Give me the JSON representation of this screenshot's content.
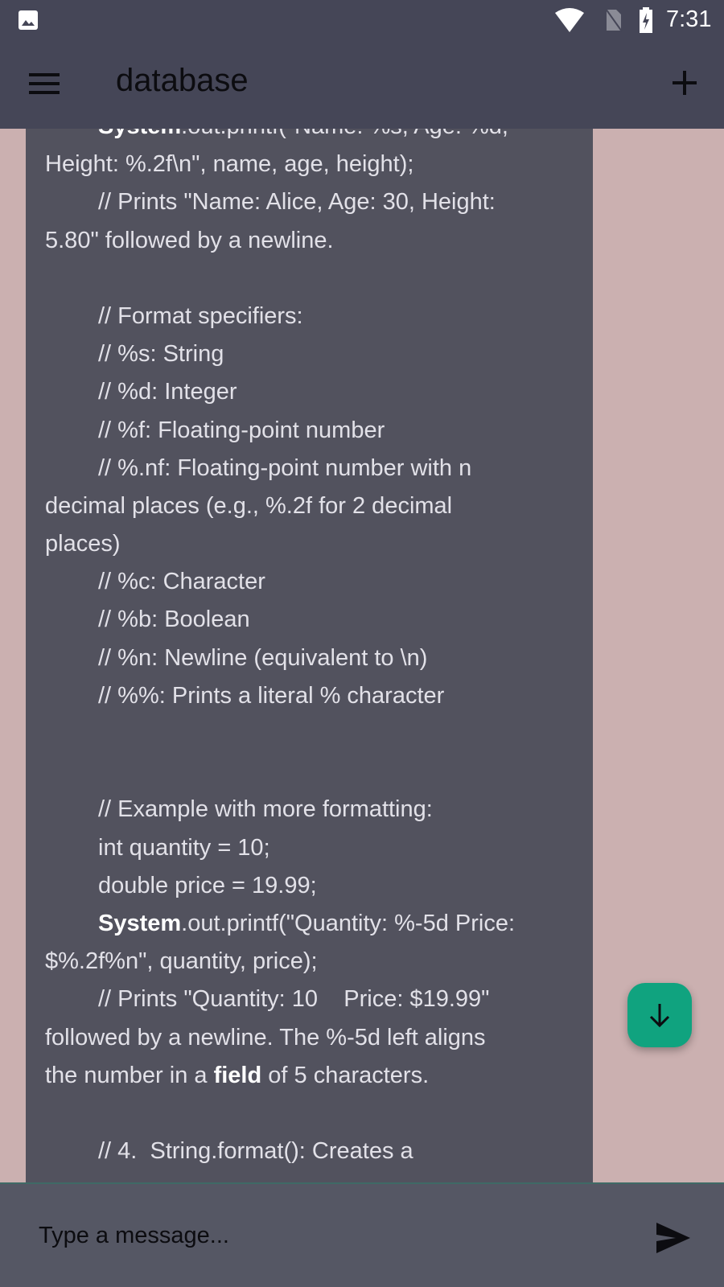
{
  "status_bar": {
    "time": "7:31",
    "icons": [
      "image-icon",
      "wifi-icon",
      "no-sim-icon",
      "battery-charging-icon"
    ]
  },
  "app_bar": {
    "title": "database",
    "menu_icon": "menu-icon",
    "add_icon": "plus-icon"
  },
  "message": {
    "lines": [
      {
        "indent": true,
        "segs": [
          {
            "t": "System",
            "b": true
          },
          {
            "t": ".out.printf(\"Name: %s, Age: %d,"
          }
        ]
      },
      {
        "indent": false,
        "segs": [
          {
            "t": "Height: %.2f\\n\", name, age, height);"
          }
        ]
      },
      {
        "indent": true,
        "segs": [
          {
            "t": "// Prints \"Name: Alice, Age: 30, Height:"
          }
        ]
      },
      {
        "indent": false,
        "segs": [
          {
            "t": "5.80\" followed by a newline."
          }
        ]
      },
      {
        "indent": false,
        "segs": [
          {
            "t": ""
          }
        ]
      },
      {
        "indent": true,
        "segs": [
          {
            "t": "// Format specifiers:"
          }
        ]
      },
      {
        "indent": true,
        "segs": [
          {
            "t": "// %s: String"
          }
        ]
      },
      {
        "indent": true,
        "segs": [
          {
            "t": "// %d: Integer"
          }
        ]
      },
      {
        "indent": true,
        "segs": [
          {
            "t": "// %f: Floating-point number"
          }
        ]
      },
      {
        "indent": true,
        "segs": [
          {
            "t": "// %.nf: Floating-point number with n"
          }
        ]
      },
      {
        "indent": false,
        "segs": [
          {
            "t": "decimal places (e.g., %.2f for 2 decimal"
          }
        ]
      },
      {
        "indent": false,
        "segs": [
          {
            "t": "places)"
          }
        ]
      },
      {
        "indent": true,
        "segs": [
          {
            "t": "// %c: Character"
          }
        ]
      },
      {
        "indent": true,
        "segs": [
          {
            "t": "// %b: Boolean"
          }
        ]
      },
      {
        "indent": true,
        "segs": [
          {
            "t": "// %n: Newline (equivalent to \\n)"
          }
        ]
      },
      {
        "indent": true,
        "segs": [
          {
            "t": "// %%: Prints a literal % character"
          }
        ]
      },
      {
        "indent": false,
        "segs": [
          {
            "t": ""
          }
        ]
      },
      {
        "indent": false,
        "segs": [
          {
            "t": ""
          }
        ]
      },
      {
        "indent": true,
        "segs": [
          {
            "t": "// Example with more formatting:"
          }
        ]
      },
      {
        "indent": true,
        "segs": [
          {
            "t": "int quantity = 10;"
          }
        ]
      },
      {
        "indent": true,
        "segs": [
          {
            "t": "double price = 19.99;"
          }
        ]
      },
      {
        "indent": true,
        "segs": [
          {
            "t": "System",
            "b": true
          },
          {
            "t": ".out.printf(\"Quantity: %-5d Price:"
          }
        ]
      },
      {
        "indent": false,
        "segs": [
          {
            "t": "$%.2f%n\", quantity, price);"
          }
        ]
      },
      {
        "indent": true,
        "segs": [
          {
            "t": "// Prints \"Quantity: 10    Price: $19.99\""
          }
        ]
      },
      {
        "indent": false,
        "segs": [
          {
            "t": "followed by a newline. The %-5d left aligns"
          }
        ]
      },
      {
        "indent": false,
        "segs": [
          {
            "t": "the number in a "
          },
          {
            "t": "field",
            "b": true
          },
          {
            "t": " of 5 characters."
          }
        ]
      },
      {
        "indent": false,
        "segs": [
          {
            "t": ""
          }
        ]
      },
      {
        "indent": true,
        "segs": [
          {
            "t": "// 4.  String.format(): Creates a"
          }
        ]
      }
    ]
  },
  "fab": {
    "icon": "arrow-down-icon"
  },
  "input": {
    "placeholder": "Type a message...",
    "send_icon": "send-icon"
  },
  "colors": {
    "bar": "#454657",
    "background": "#cbb0b0",
    "bubble": "#52525e",
    "fab": "#10a37f",
    "input_bar": "#555764"
  }
}
